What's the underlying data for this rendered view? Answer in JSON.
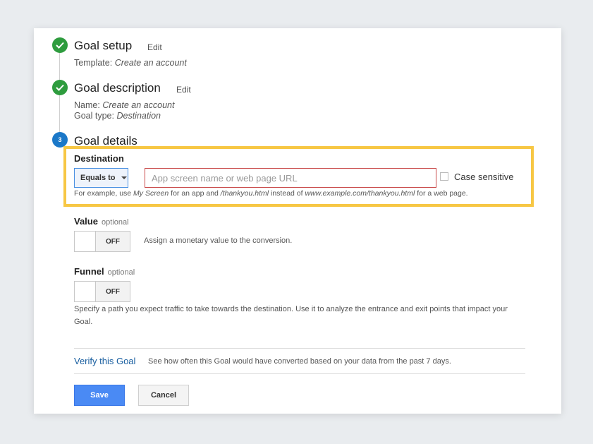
{
  "steps": {
    "setup": {
      "title": "Goal setup",
      "edit_label": "Edit",
      "template_label": "Template:",
      "template_value": "Create an account"
    },
    "description": {
      "title": "Goal description",
      "edit_label": "Edit",
      "name_label": "Name:",
      "name_value": "Create an account",
      "type_label": "Goal type:",
      "type_value": "Destination"
    },
    "details": {
      "number": "3",
      "title": "Goal details"
    }
  },
  "destination": {
    "label": "Destination",
    "match_type": "Equals to",
    "input_value": "",
    "input_placeholder": "App screen name or web page URL",
    "case_sensitive_label": "Case sensitive",
    "case_sensitive_checked": false,
    "hint": {
      "p1": "For example, use ",
      "e1": "My Screen",
      "p2": " for an app and ",
      "e2": "/thankyou.html",
      "p3": " instead of ",
      "e3": "www.example.com/thankyou.html",
      "p4": " for a web page."
    }
  },
  "value": {
    "label": "Value",
    "optional": "optional",
    "toggle_state": "OFF",
    "description": "Assign a monetary value to the conversion."
  },
  "funnel": {
    "label": "Funnel",
    "optional": "optional",
    "toggle_state": "OFF",
    "description": "Specify a path you expect traffic to take towards the destination. Use it to analyze the entrance and exit points that impact your Goal."
  },
  "verify": {
    "link": "Verify this Goal",
    "description": "See how often this Goal would have converted based on your data from the past 7 days."
  },
  "actions": {
    "save": "Save",
    "cancel": "Cancel"
  },
  "colors": {
    "check": "#2e9c3e",
    "step_number": "#1b78c8",
    "highlight": "#f7c744",
    "link": "#1a5fa0",
    "primary_button": "#4a8af4",
    "input_error_border": "#c94a4a"
  }
}
